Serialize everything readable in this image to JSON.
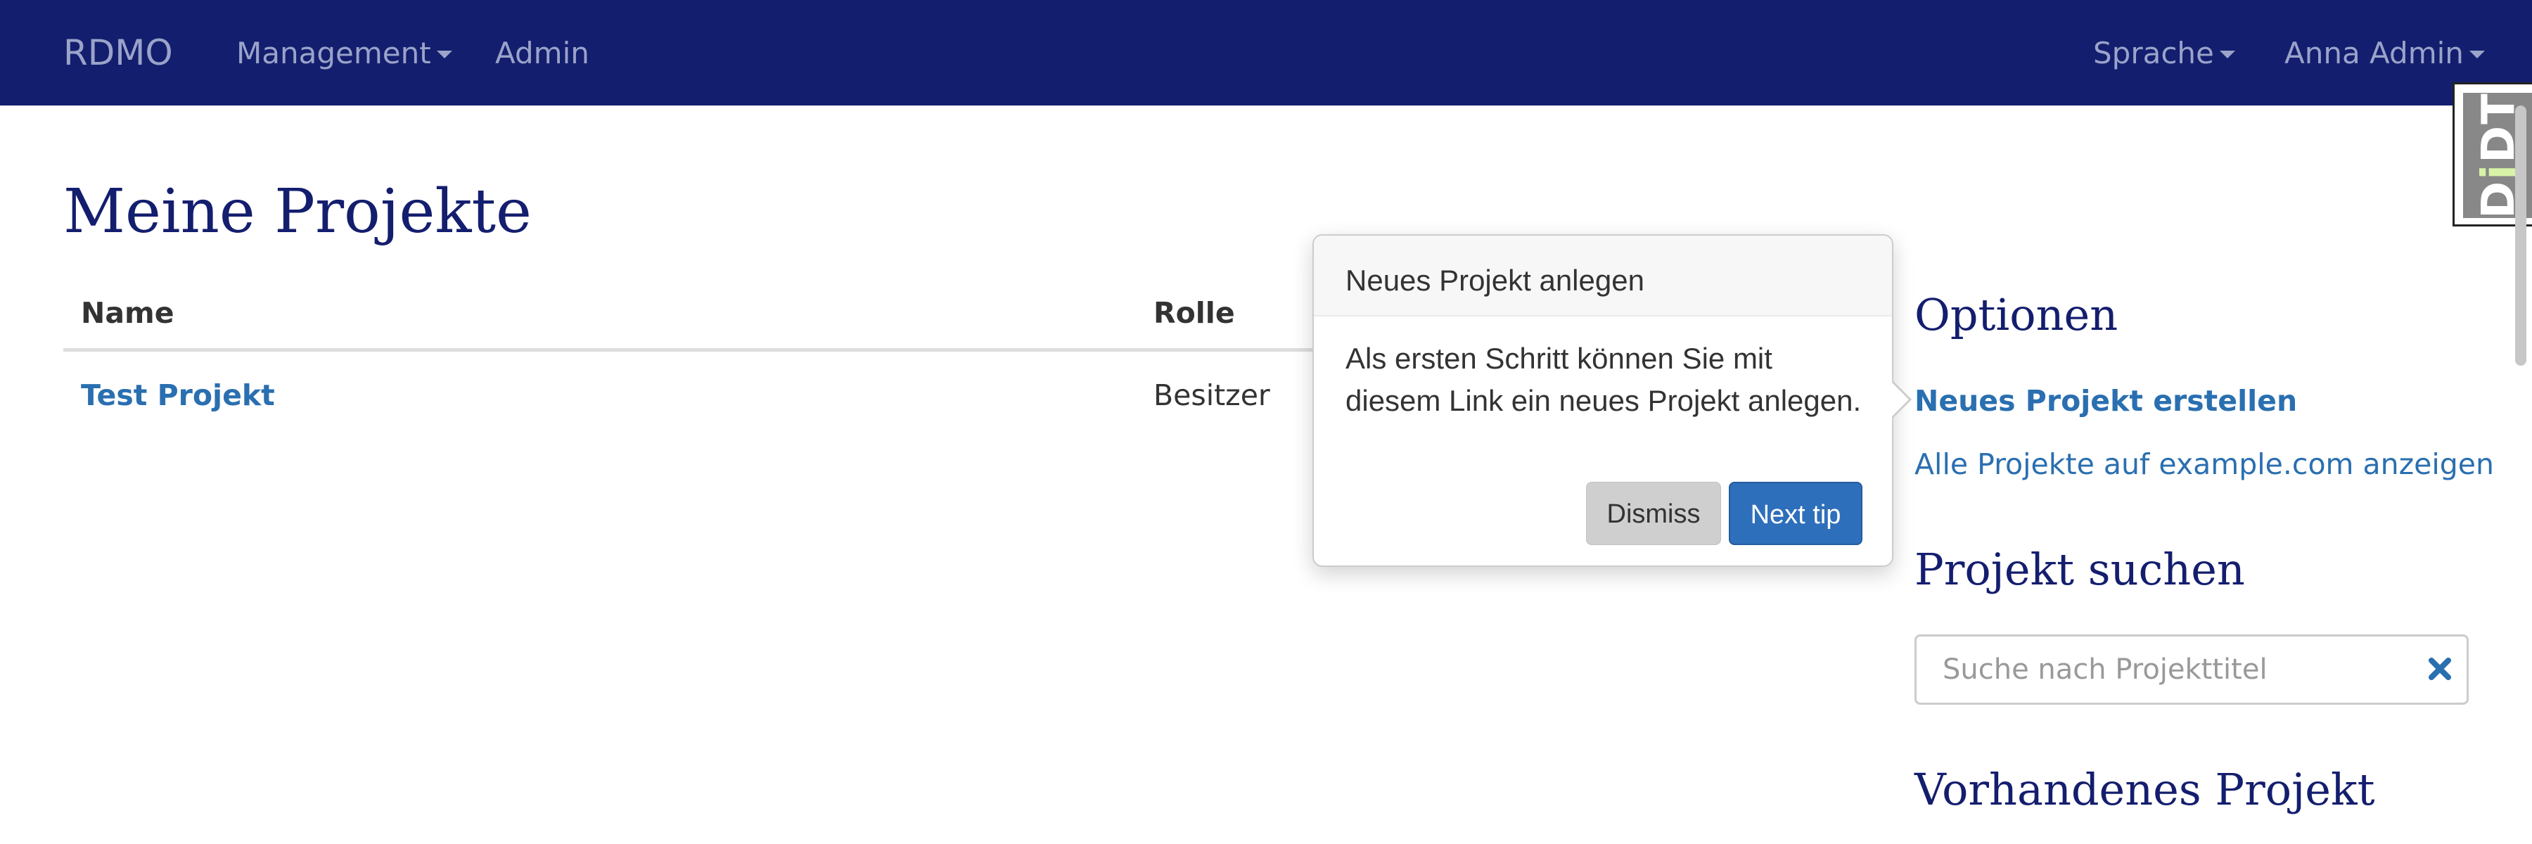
{
  "navbar": {
    "brand": "RDMO",
    "management": "Management",
    "admin": "Admin",
    "language": "Sprache",
    "user": "Anna Admin"
  },
  "debug_toolbar": {
    "label_d": "D",
    "label_j": "j",
    "label_dt": "DT"
  },
  "main": {
    "title": "Meine Projekte",
    "table": {
      "headers": [
        "Name",
        "Rolle"
      ],
      "rows": [
        {
          "name": "Test Projekt",
          "role": "Besitzer"
        }
      ]
    }
  },
  "popover": {
    "title": "Neues Projekt anlegen",
    "body": "Als ersten Schritt können Sie mit diesem Link ein neues Projekt anlegen.",
    "dismiss_label": "Dismiss",
    "next_label": "Next tip"
  },
  "sidebar": {
    "options_heading": "Optionen",
    "new_project_link": "Neues Projekt erstellen",
    "all_projects_link": "Alle Projekte auf example.com anzeigen",
    "search_heading": "Projekt suchen",
    "search_placeholder": "Suche nach Projekttitel",
    "existing_heading": "Vorhandenes Projekt"
  },
  "colors": {
    "navbar_bg": "#141e6e",
    "heading": "#141e6e",
    "link": "#2a6fb0",
    "primary_button": "#2e6fbb"
  }
}
